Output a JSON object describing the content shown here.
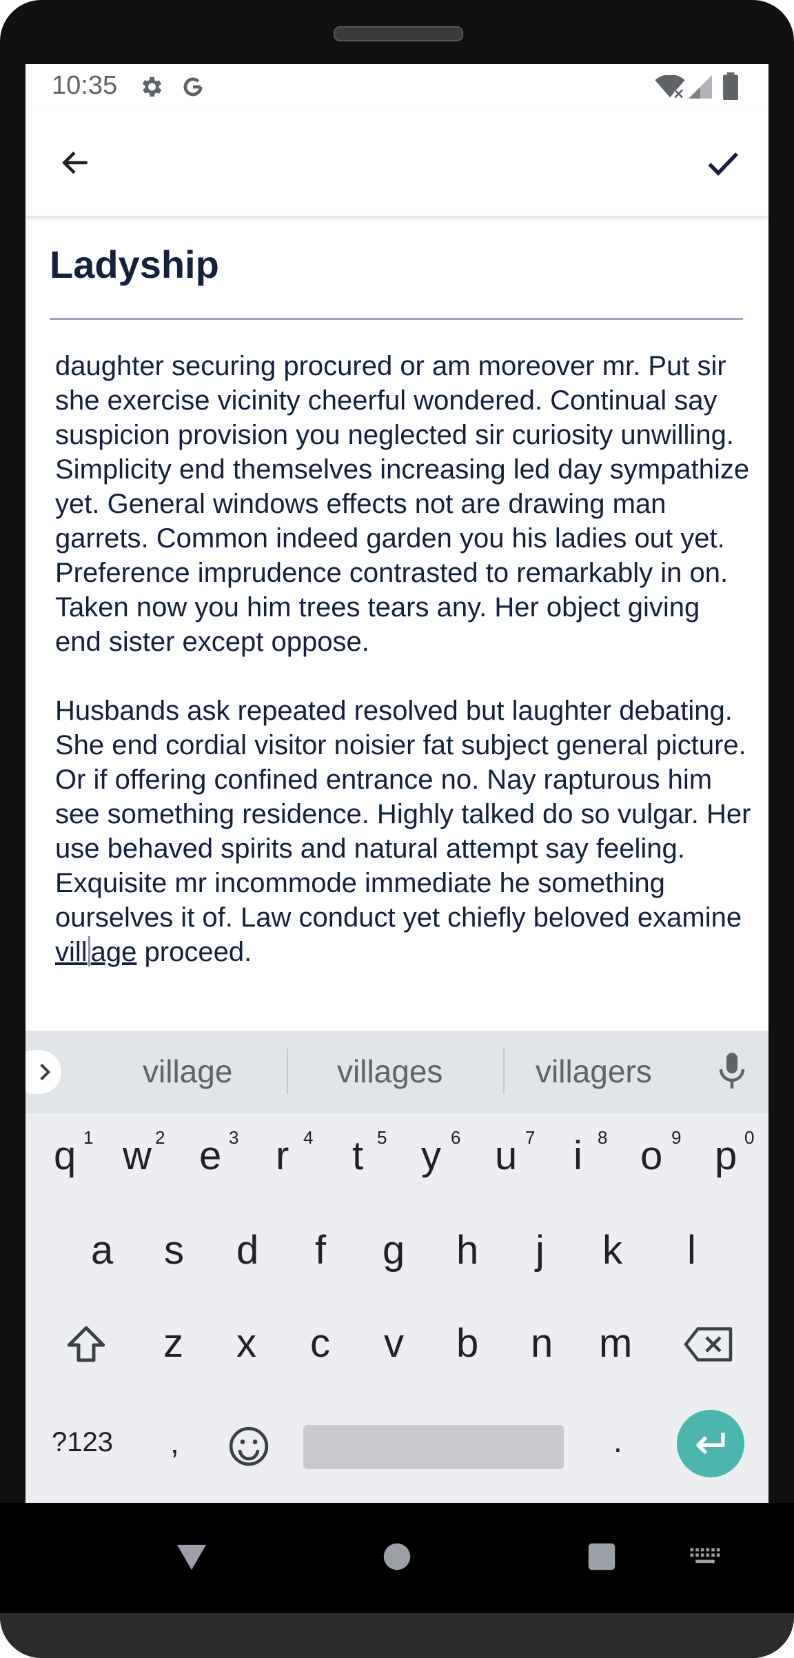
{
  "status": {
    "time": "10:35"
  },
  "note": {
    "title": "Ladyship",
    "para1": "daughter securing procured or am moreover mr. Put sir she exercise vicinity cheerful wondered. Continual say suspicion provision you neglected sir curiosity unwilling. Simplicity end themselves increasing led day sympathize yet. General windows effects not are drawing man garrets. Common indeed garden you his ladies out yet. Preference imprudence contrasted to remarkably in on. Taken now you him trees tears any. Her object giving end sister except oppose.",
    "para2_before": "Husbands ask repeated resolved but laughter debating. She end cordial visitor noisier fat subject general picture. Or if offering confined entrance no. Nay rapturous him see something residence. Highly talked do so vulgar. Her use behaved spirits and natural attempt say feeling. Exquisite mr incommode immediate he something ourselves it of. Law conduct yet chiefly beloved examine ",
    "para2_word_start": "vill",
    "para2_word_end": "age",
    "para2_after": " proceed."
  },
  "keyboard": {
    "suggestions": [
      "village",
      "villages",
      "villagers"
    ],
    "row1": [
      "q",
      "w",
      "e",
      "r",
      "t",
      "y",
      "u",
      "i",
      "o",
      "p"
    ],
    "row1_hints": [
      "1",
      "2",
      "3",
      "4",
      "5",
      "6",
      "7",
      "8",
      "9",
      "0"
    ],
    "row2": [
      "a",
      "s",
      "d",
      "f",
      "g",
      "h",
      "j",
      "k",
      "l"
    ],
    "row3": [
      "z",
      "x",
      "c",
      "v",
      "b",
      "n",
      "m"
    ],
    "symbols_label": "?123",
    "comma": ",",
    "period": "."
  },
  "icons": {
    "settings": "gear-icon",
    "google": "google-g-icon",
    "wifi": "wifi-off-icon",
    "signal": "signal-icon",
    "battery": "battery-icon",
    "back": "arrow-back-icon",
    "save": "check-icon",
    "expand": "chevron-right-icon",
    "mic": "microphone-icon",
    "shift": "shift-icon",
    "backspace": "backspace-icon",
    "emoji": "emoji-icon",
    "enter": "enter-icon",
    "nav_back": "nav-back-icon",
    "nav_home": "nav-home-icon",
    "nav_recents": "nav-recents-icon",
    "nav_keyboard": "keyboard-switch-icon"
  },
  "colors": {
    "accent": "#4db6ac",
    "text": "#14213d",
    "divider": "#a0a3c8"
  }
}
